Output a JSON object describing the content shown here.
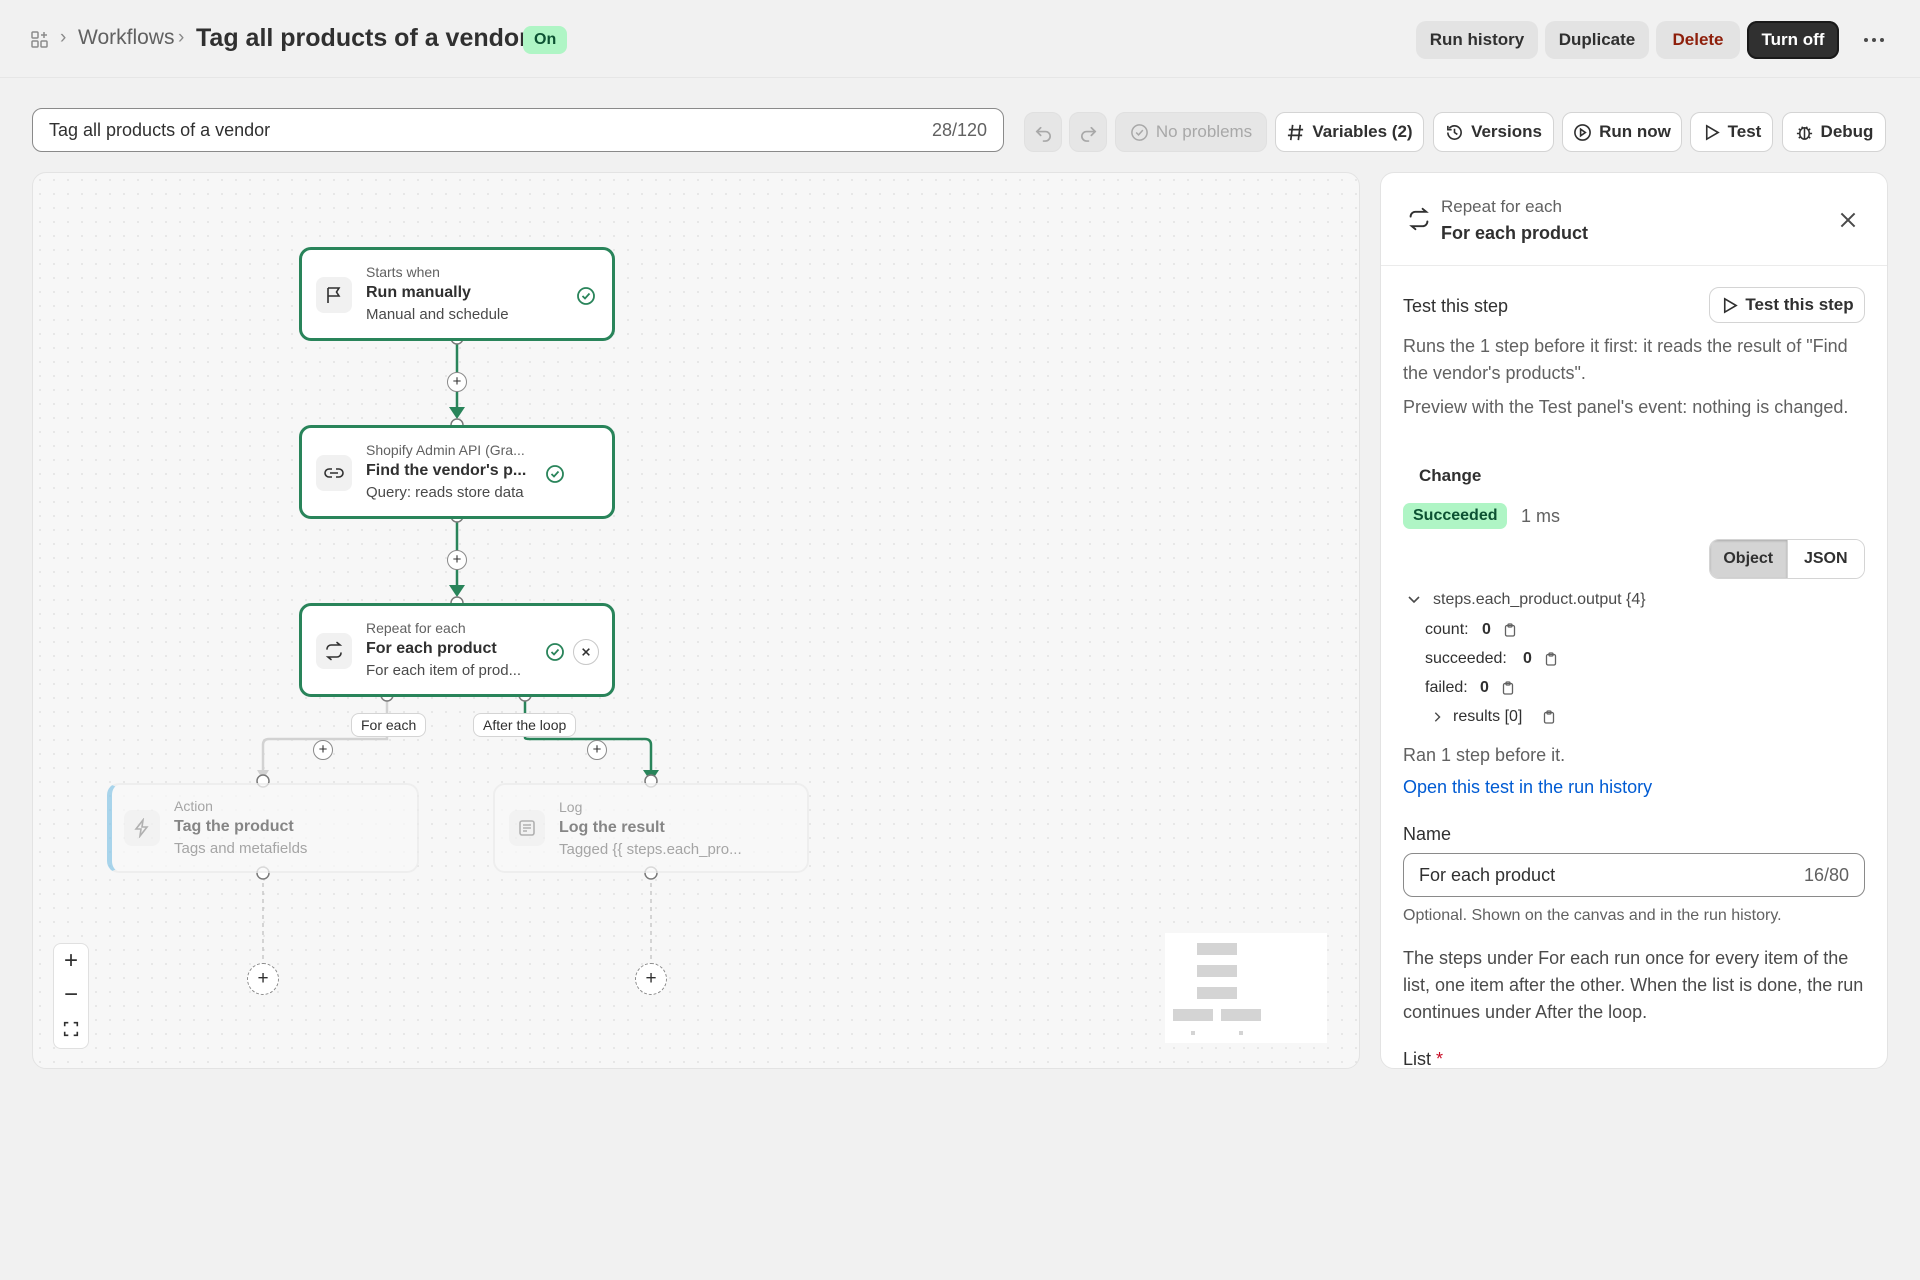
{
  "header": {
    "breadcrumb_link": "Workflows",
    "title": "Tag all products of a vendor",
    "status_badge": "On",
    "buttons": {
      "run_history": "Run history",
      "duplicate": "Duplicate",
      "delete": "Delete",
      "turn_off": "Turn off"
    }
  },
  "toolbar": {
    "name_value": "Tag all products of a vendor",
    "name_count": "28/120",
    "no_problems": "No problems",
    "variables": "Variables (2)",
    "versions": "Versions",
    "run_now": "Run now",
    "test": "Test",
    "debug": "Debug"
  },
  "canvas": {
    "nodes": {
      "trigger": {
        "kind": "Starts when",
        "title": "Run manually",
        "subtitle": "Manual and schedule"
      },
      "query": {
        "kind": "Shopify Admin API (Gra...",
        "title": "Find the vendor's p...",
        "subtitle": "Query: reads store data"
      },
      "loop": {
        "kind": "Repeat for each",
        "title": "For each product",
        "subtitle": "For each item of prod..."
      },
      "action": {
        "kind": "Action",
        "title": "Tag the product",
        "subtitle": "Tags and metafields"
      },
      "log": {
        "kind": "Log",
        "title": "Log the result",
        "subtitle": "Tagged {{ steps.each_pro..."
      }
    },
    "branches": {
      "for_each": "For each",
      "after_loop": "After the loop"
    },
    "zoom": {
      "in": "+",
      "out": "−"
    }
  },
  "panel": {
    "kind": "Repeat for each",
    "title": "For each product",
    "test_heading": "Test this step",
    "test_button": "Test this step",
    "description_1": "Runs the 1 step before it first: it reads the result of \"Find the vendor's products\".",
    "description_2": "Preview with the Test panel's event: nothing is changed.",
    "change_link": "Change",
    "status": "Succeeded",
    "duration": "1 ms",
    "view_toggle": {
      "object": "Object",
      "json": "JSON"
    },
    "output": {
      "root": "steps.each_product.output {4}",
      "count_label": "count:",
      "count_value": "0",
      "succeeded_label": "succeeded:",
      "succeeded_value": "0",
      "failed_label": "failed:",
      "failed_value": "0",
      "results": "results [0]"
    },
    "ran_before": "Ran 1 step before it.",
    "open_link": "Open this test in the run history",
    "name_label": "Name",
    "name_value": "For each product",
    "name_count": "16/80",
    "name_help": "Optional. Shown on the canvas and in the run history.",
    "loop_help": "The steps under For each run once for every item of the list, one item after the other. When the list is done, the run continues under After the loop.",
    "list_label": "List",
    "required_mark": "*"
  },
  "colors": {
    "accent_green": "#29845a",
    "success_bg": "#aff5c5",
    "link_blue": "#005bd3",
    "danger": "#8e1f0b"
  }
}
